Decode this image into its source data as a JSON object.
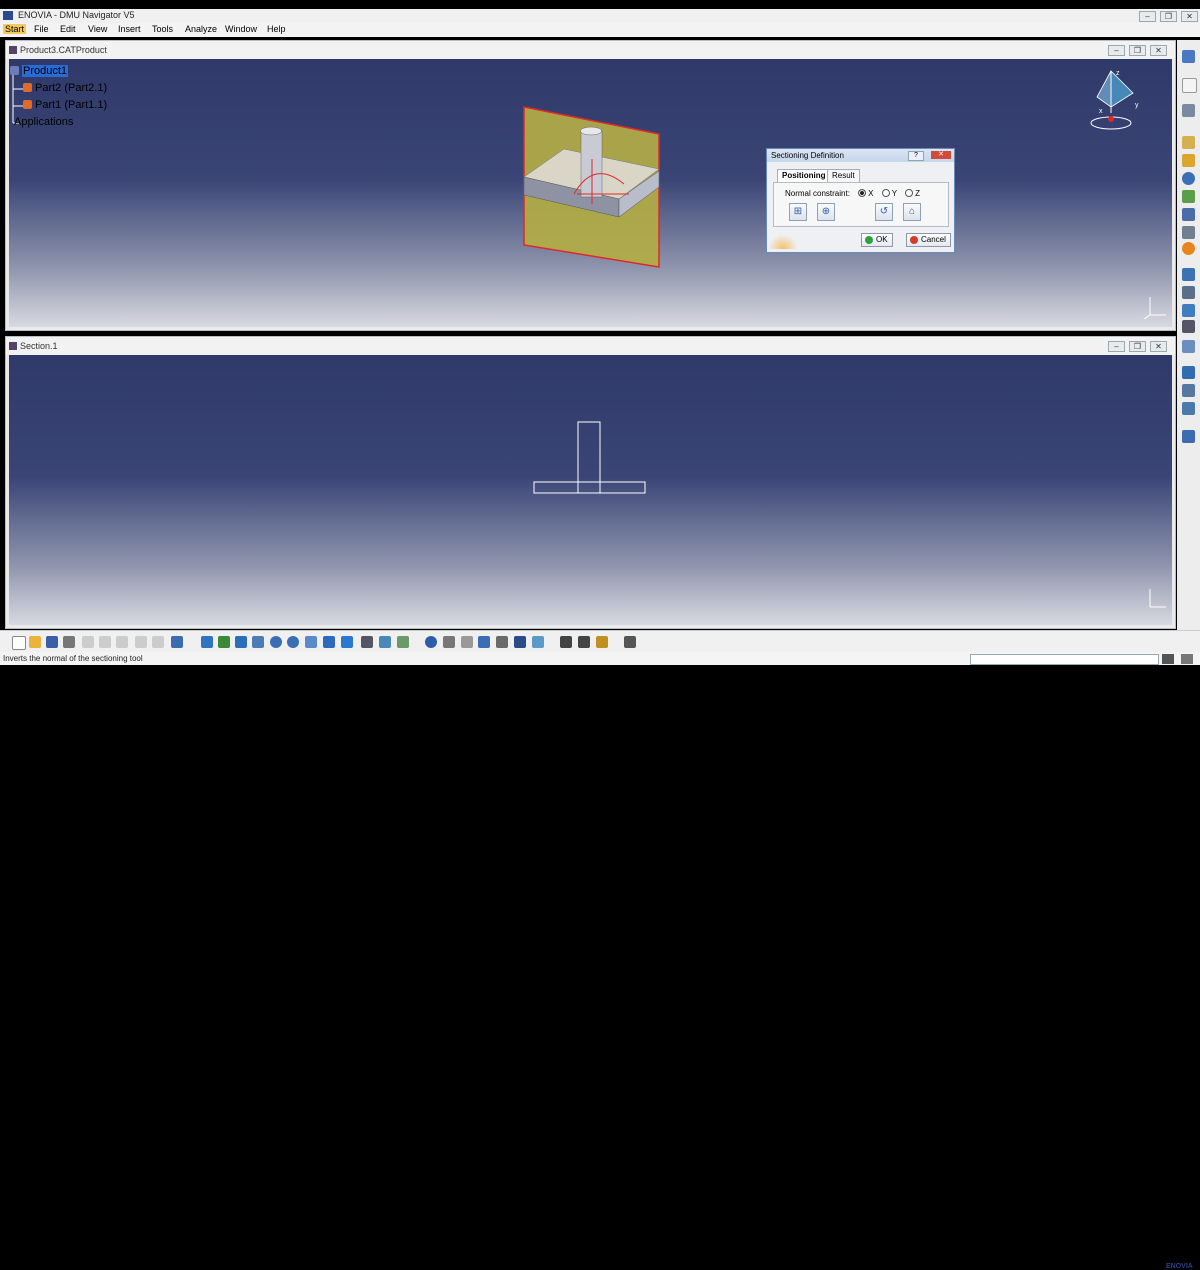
{
  "window": {
    "title": "ENOVIA - DMU Navigator V5"
  },
  "menu": [
    "Start",
    "File",
    "Edit",
    "View",
    "Insert",
    "Tools",
    "Analyze",
    "Window",
    "Help"
  ],
  "top_pane": {
    "title": "Product3.CATProduct",
    "tree": {
      "root": "Product1",
      "children": [
        "Part2 (Part2.1)",
        "Part1 (Part1.1)"
      ],
      "applications": "Applications"
    }
  },
  "bottom_pane": {
    "title": "Section.1"
  },
  "dialog": {
    "title": "Sectioning Definition",
    "tabs": [
      "Positioning",
      "Result"
    ],
    "normal_label": "Normal constraint:",
    "radios": [
      {
        "label": "X",
        "selected": true
      },
      {
        "label": "Y",
        "selected": false
      },
      {
        "label": "Z",
        "selected": false
      }
    ],
    "ok": "OK",
    "cancel": "Cancel"
  },
  "compass": {
    "x": "x",
    "y": "y",
    "z": "z"
  },
  "status": {
    "message": "Inverts the normal of the sectioning tool",
    "input_value": ""
  },
  "brand": "ENOVIA",
  "colors": {
    "viewport_top": "#2f3a6a",
    "viewport_bottom": "#d8d9e1",
    "plane_fill": "#b3ad45",
    "plane_border": "#e02828",
    "selection": "#2a6bd8"
  }
}
